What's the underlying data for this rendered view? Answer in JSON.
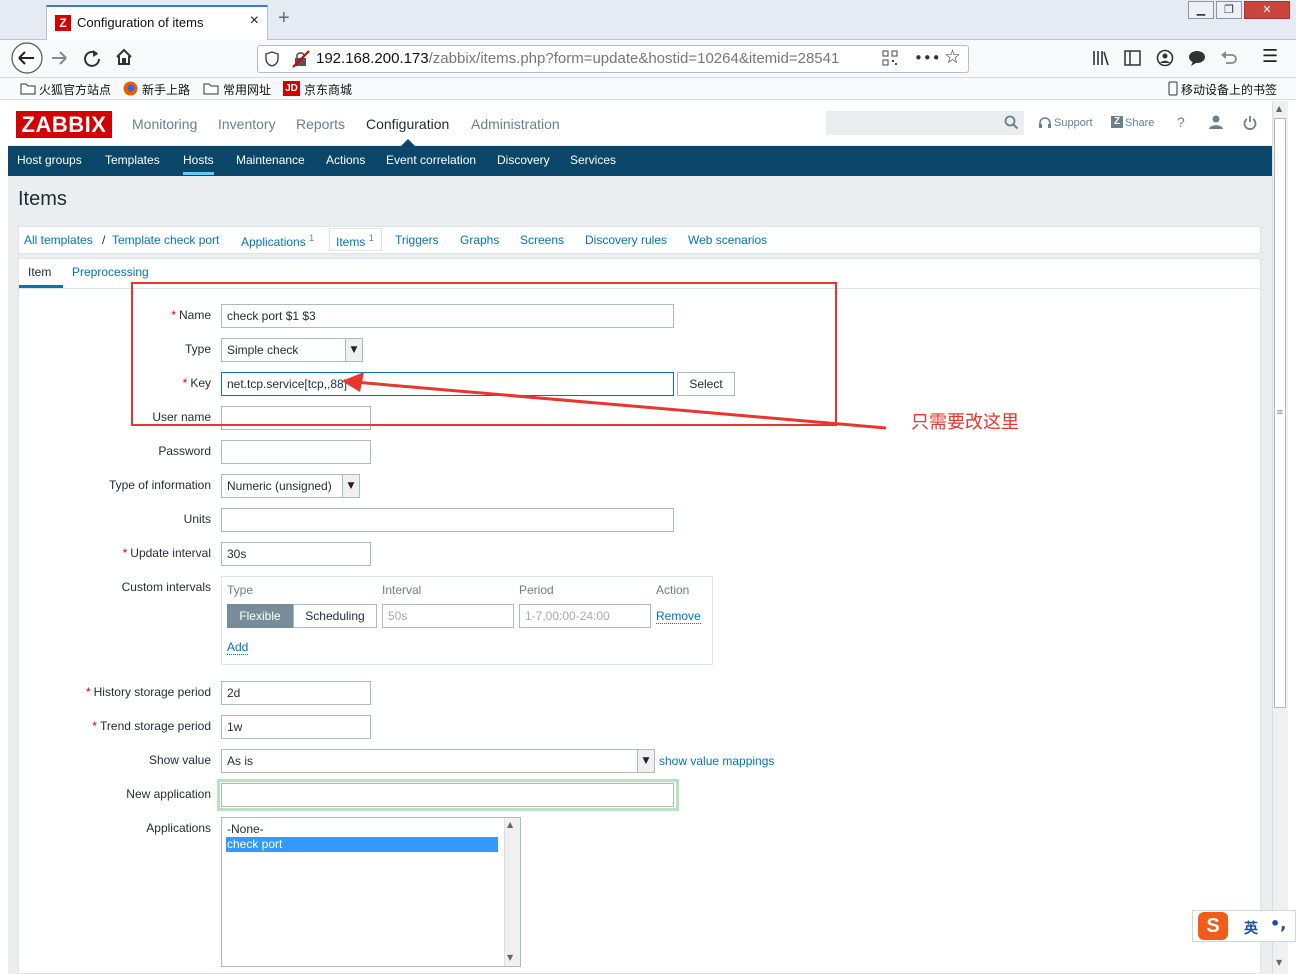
{
  "browser": {
    "tab_title": "Configuration of items",
    "tab_close": "×",
    "new_tab": "+",
    "url_host": "192.168.200.173",
    "url_path": "/zabbix/items.php?form=update&hostid=10264&itemid=28541",
    "more": "•••",
    "bookmarks": [
      "火狐官方站点",
      "新手上路",
      "常用网址",
      "京东商城"
    ],
    "mobile_bookmarks": "移动设备上的书签"
  },
  "zabbix": {
    "logo": "ZABBIX",
    "main_menu": [
      "Monitoring",
      "Inventory",
      "Reports",
      "Configuration",
      "Administration"
    ],
    "header_links": {
      "support": "Support",
      "share": "Share",
      "help": "?"
    },
    "sub_menu": [
      "Host groups",
      "Templates",
      "Hosts",
      "Maintenance",
      "Actions",
      "Event correlation",
      "Discovery",
      "Services"
    ],
    "active_sub": "Hosts"
  },
  "page": {
    "title": "Items",
    "breadcrumbs": {
      "all_templates": "All templates",
      "sep": "/",
      "template": "Template check port",
      "applications": "Applications",
      "applications_count": "1",
      "items": "Items",
      "items_count": "1",
      "triggers": "Triggers",
      "graphs": "Graphs",
      "screens": "Screens",
      "discovery_rules": "Discovery rules",
      "web_scenarios": "Web scenarios"
    },
    "form_tabs": [
      "Item",
      "Preprocessing"
    ]
  },
  "form": {
    "name_label": "Name",
    "name_value": "check port $1 $3",
    "type_label": "Type",
    "type_value": "Simple check",
    "key_label": "Key",
    "key_value": "net.tcp.service[tcp,,88]",
    "select_button": "Select",
    "username_label": "User name",
    "password_label": "Password",
    "type_info_label": "Type of information",
    "type_info_value": "Numeric (unsigned)",
    "units_label": "Units",
    "update_label": "Update interval",
    "update_value": "30s",
    "custom_intervals_label": "Custom intervals",
    "ci_headers": [
      "Type",
      "Interval",
      "Period",
      "Action"
    ],
    "ci_flexible": "Flexible",
    "ci_scheduling": "Scheduling",
    "ci_interval_placeholder": "50s",
    "ci_period_placeholder": "1-7,00:00-24:00",
    "ci_remove": "Remove",
    "ci_add": "Add",
    "history_label": "History storage period",
    "history_value": "2d",
    "trend_label": "Trend storage period",
    "trend_value": "1w",
    "show_value_label": "Show value",
    "show_value_value": "As is",
    "show_value_mappings": "show value mappings",
    "new_app_label": "New application",
    "applications_label": "Applications",
    "applications_options": [
      "-None-",
      "check port"
    ],
    "required_mark": "*"
  },
  "annotation": {
    "text": "只需要改这里",
    "color": "#e8352e"
  },
  "ime": {
    "mode": "英"
  },
  "colors": {
    "zabbix_red": "#d40000",
    "subnav_bg": "#0a466a",
    "link": "#0275b8",
    "annotation": "#e8352e"
  }
}
